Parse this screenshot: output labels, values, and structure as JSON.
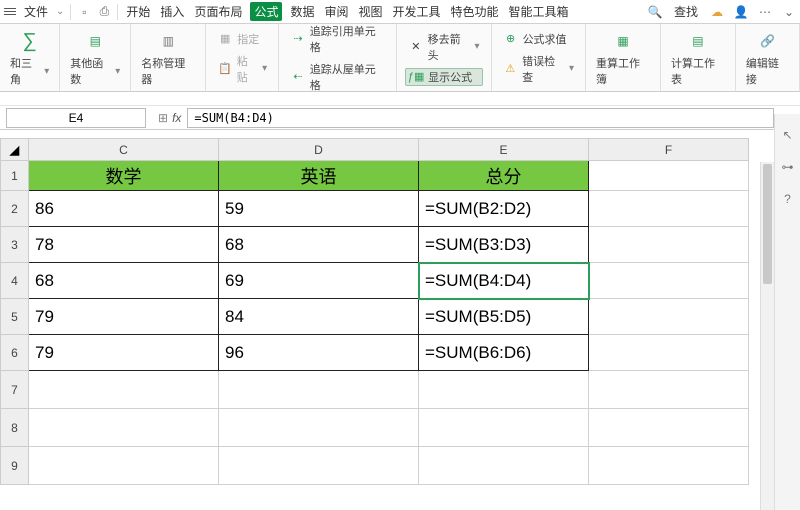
{
  "menubar": {
    "file": "文件",
    "tabs": [
      "开始",
      "插入",
      "页面布局",
      "公式",
      "数据",
      "审阅",
      "视图",
      "开发工具",
      "特色功能",
      "智能工具箱"
    ],
    "active_tab_index": 3,
    "search": "查找"
  },
  "ribbon": {
    "sum": "和三角",
    "other": "其他函数",
    "name_mgr": "名称管理器",
    "paste": "粘贴",
    "specify": "指定",
    "trace_prec": "追踪引用单元格",
    "trace_dep": "追踪从屋单元格",
    "remove_arrows": "移去箭头",
    "show_formulas": "显示公式",
    "eval": "公式求值",
    "err_check": "错误检查",
    "recalc_wb": "重算工作簿",
    "calc_sheet": "计算工作表",
    "edit_link": "编辑链接"
  },
  "fx": {
    "cell_ref": "E4",
    "formula": "=SUM(B4:D4)"
  },
  "sheet": {
    "cols": [
      "C",
      "D",
      "E",
      "F"
    ],
    "rows": [
      "1",
      "2",
      "3",
      "4",
      "5",
      "6",
      "7",
      "8",
      "9"
    ],
    "headers": {
      "C": "数学",
      "D": "英语",
      "E": "总分"
    },
    "data": [
      {
        "C": "86",
        "D": "59",
        "E": "=SUM(B2:D2)"
      },
      {
        "C": "78",
        "D": "68",
        "E": "=SUM(B3:D3)"
      },
      {
        "C": "68",
        "D": "69",
        "E": "=SUM(B4:D4)"
      },
      {
        "C": "79",
        "D": "84",
        "E": "=SUM(B5:D5)"
      },
      {
        "C": "79",
        "D": "96",
        "E": "=SUM(B6:D6)"
      }
    ],
    "selected": "E4"
  },
  "chart_data": {
    "type": "table",
    "title": "",
    "columns": [
      "数学",
      "英语",
      "总分"
    ],
    "rows": [
      {
        "数学": 86,
        "英语": 59,
        "总分": "=SUM(B2:D2)"
      },
      {
        "数学": 78,
        "英语": 68,
        "总分": "=SUM(B3:D3)"
      },
      {
        "数学": 68,
        "英语": 69,
        "总分": "=SUM(B4:D4)"
      },
      {
        "数学": 79,
        "英语": 84,
        "总分": "=SUM(B5:D5)"
      },
      {
        "数学": 79,
        "英语": 96,
        "总分": "=SUM(B6:D6)"
      }
    ]
  }
}
